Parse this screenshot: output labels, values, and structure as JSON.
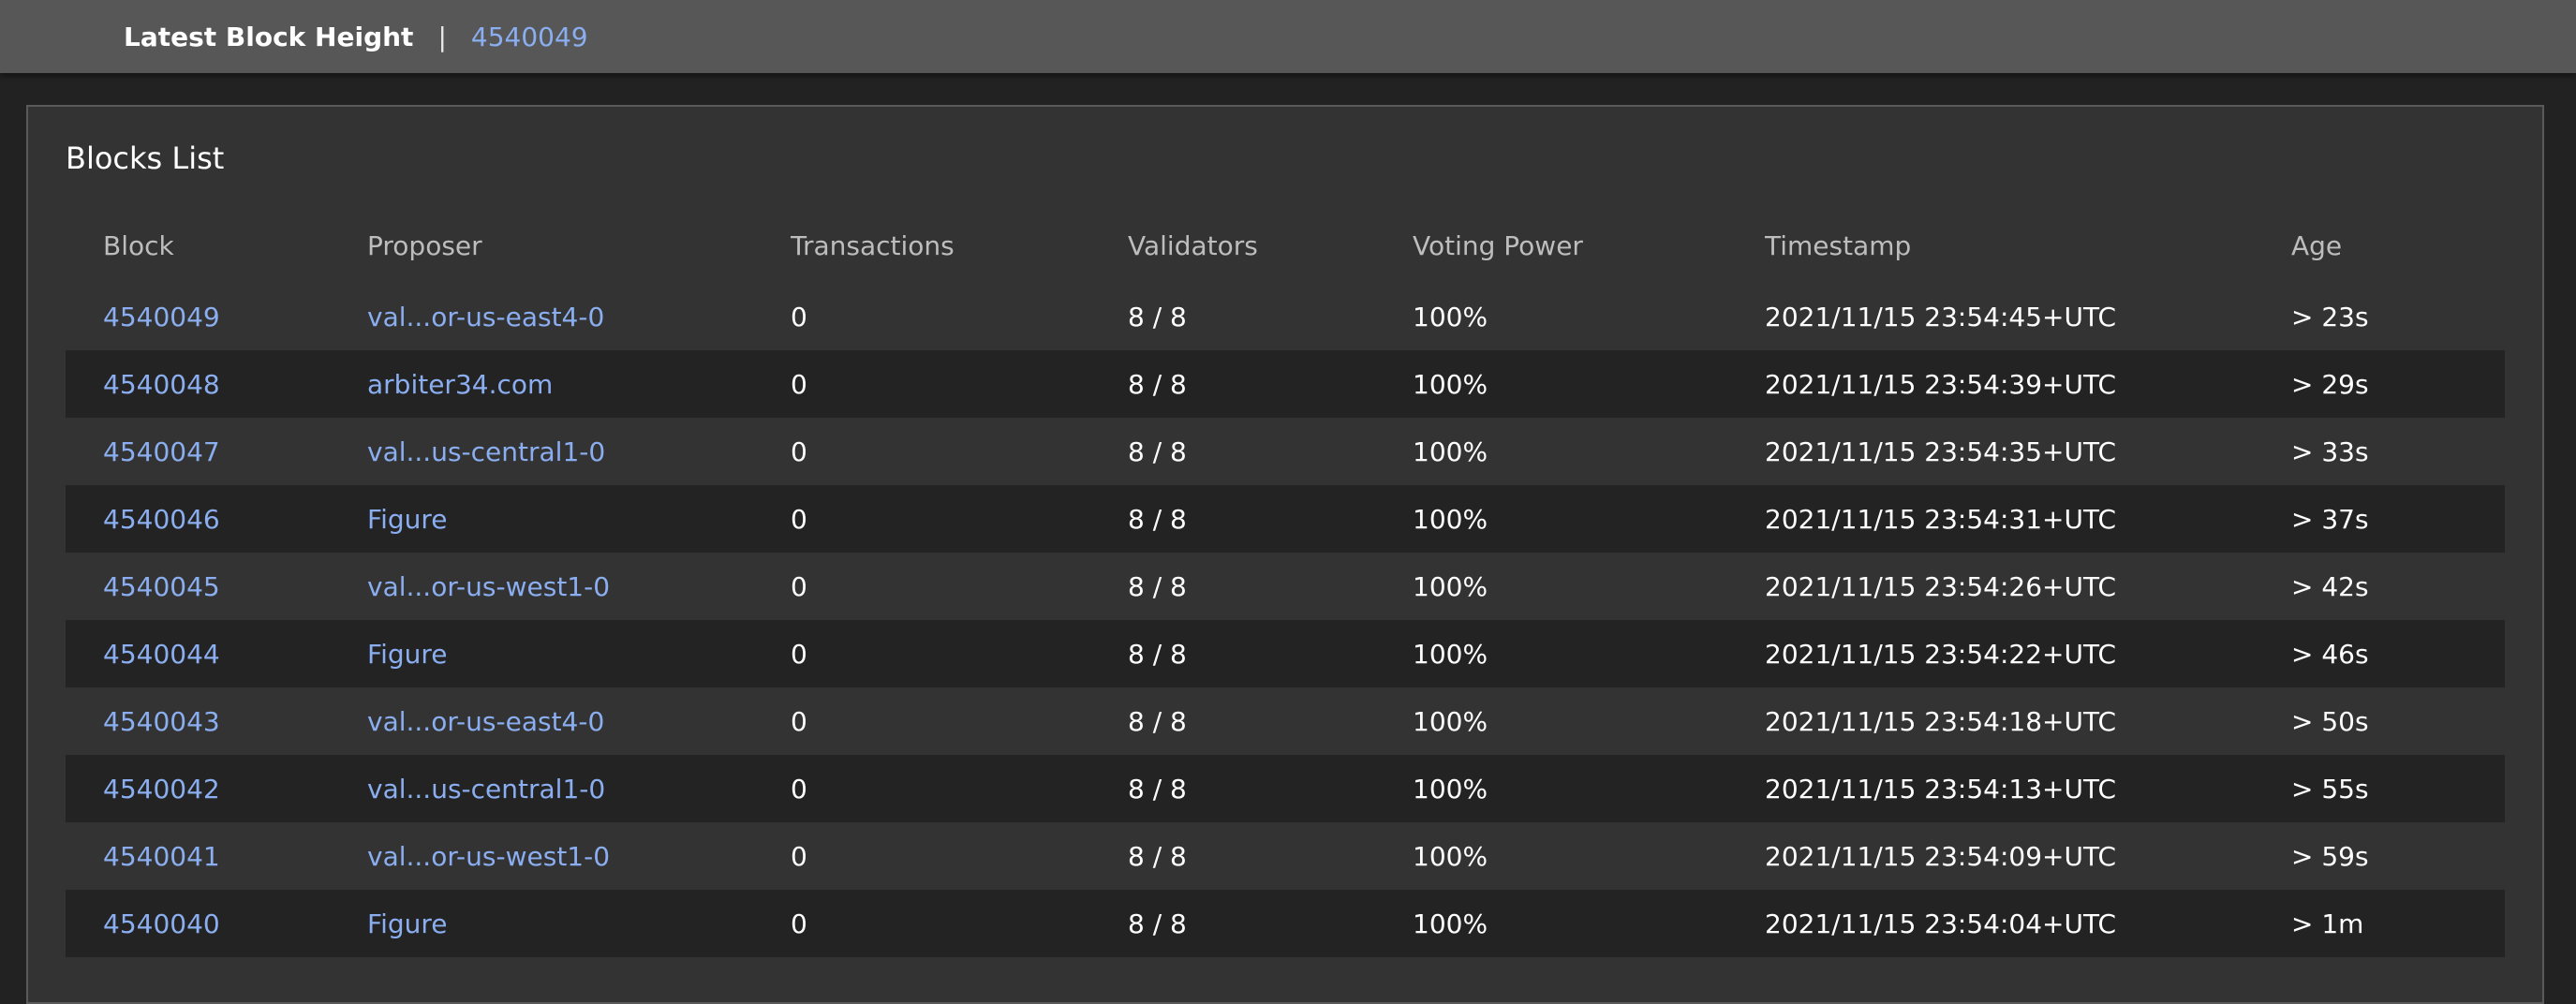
{
  "header": {
    "latest_label": "Latest Block Height",
    "separator": "|",
    "latest_value": "4540049"
  },
  "blocks": {
    "title": "Blocks List",
    "columns": [
      "Block",
      "Proposer",
      "Transactions",
      "Validators",
      "Voting Power",
      "Timestamp",
      "Age"
    ],
    "rows": [
      {
        "block": "4540049",
        "proposer": "val...or-us-east4-0",
        "transactions": "0",
        "validators": "8 / 8",
        "voting_power": "100%",
        "timestamp": "2021/11/15 23:54:45+UTC",
        "age": "> 23s"
      },
      {
        "block": "4540048",
        "proposer": "arbiter34.com",
        "transactions": "0",
        "validators": "8 / 8",
        "voting_power": "100%",
        "timestamp": "2021/11/15 23:54:39+UTC",
        "age": "> 29s"
      },
      {
        "block": "4540047",
        "proposer": "val...us-central1-0",
        "transactions": "0",
        "validators": "8 / 8",
        "voting_power": "100%",
        "timestamp": "2021/11/15 23:54:35+UTC",
        "age": "> 33s"
      },
      {
        "block": "4540046",
        "proposer": "Figure",
        "transactions": "0",
        "validators": "8 / 8",
        "voting_power": "100%",
        "timestamp": "2021/11/15 23:54:31+UTC",
        "age": "> 37s"
      },
      {
        "block": "4540045",
        "proposer": "val...or-us-west1-0",
        "transactions": "0",
        "validators": "8 / 8",
        "voting_power": "100%",
        "timestamp": "2021/11/15 23:54:26+UTC",
        "age": "> 42s"
      },
      {
        "block": "4540044",
        "proposer": "Figure",
        "transactions": "0",
        "validators": "8 / 8",
        "voting_power": "100%",
        "timestamp": "2021/11/15 23:54:22+UTC",
        "age": "> 46s"
      },
      {
        "block": "4540043",
        "proposer": "val...or-us-east4-0",
        "transactions": "0",
        "validators": "8 / 8",
        "voting_power": "100%",
        "timestamp": "2021/11/15 23:54:18+UTC",
        "age": "> 50s"
      },
      {
        "block": "4540042",
        "proposer": "val...us-central1-0",
        "transactions": "0",
        "validators": "8 / 8",
        "voting_power": "100%",
        "timestamp": "2021/11/15 23:54:13+UTC",
        "age": "> 55s"
      },
      {
        "block": "4540041",
        "proposer": "val...or-us-west1-0",
        "transactions": "0",
        "validators": "8 / 8",
        "voting_power": "100%",
        "timestamp": "2021/11/15 23:54:09+UTC",
        "age": "> 59s"
      },
      {
        "block": "4540040",
        "proposer": "Figure",
        "transactions": "0",
        "validators": "8 / 8",
        "voting_power": "100%",
        "timestamp": "2021/11/15 23:54:04+UTC",
        "age": "> 1m"
      }
    ]
  }
}
